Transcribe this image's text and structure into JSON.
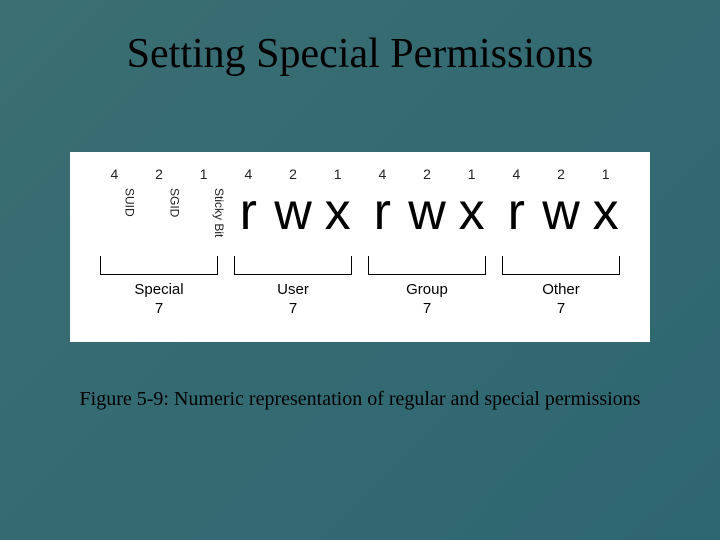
{
  "title": "Setting Special Permissions",
  "caption": "Figure 5-9: Numeric representation of regular and special permissions",
  "groups": [
    {
      "name": "Special",
      "value": "7",
      "columns": [
        {
          "num": "4",
          "label": "SUID"
        },
        {
          "num": "2",
          "label": "SGID"
        },
        {
          "num": "1",
          "label": "Sticky Bit"
        }
      ]
    },
    {
      "name": "User",
      "value": "7",
      "columns": [
        {
          "num": "4",
          "glyph": "r"
        },
        {
          "num": "2",
          "glyph": "w"
        },
        {
          "num": "1",
          "glyph": "x"
        }
      ]
    },
    {
      "name": "Group",
      "value": "7",
      "columns": [
        {
          "num": "4",
          "glyph": "r"
        },
        {
          "num": "2",
          "glyph": "w"
        },
        {
          "num": "1",
          "glyph": "x"
        }
      ]
    },
    {
      "name": "Other",
      "value": "7",
      "columns": [
        {
          "num": "4",
          "glyph": "r"
        },
        {
          "num": "2",
          "glyph": "w"
        },
        {
          "num": "1",
          "glyph": "x"
        }
      ]
    }
  ]
}
